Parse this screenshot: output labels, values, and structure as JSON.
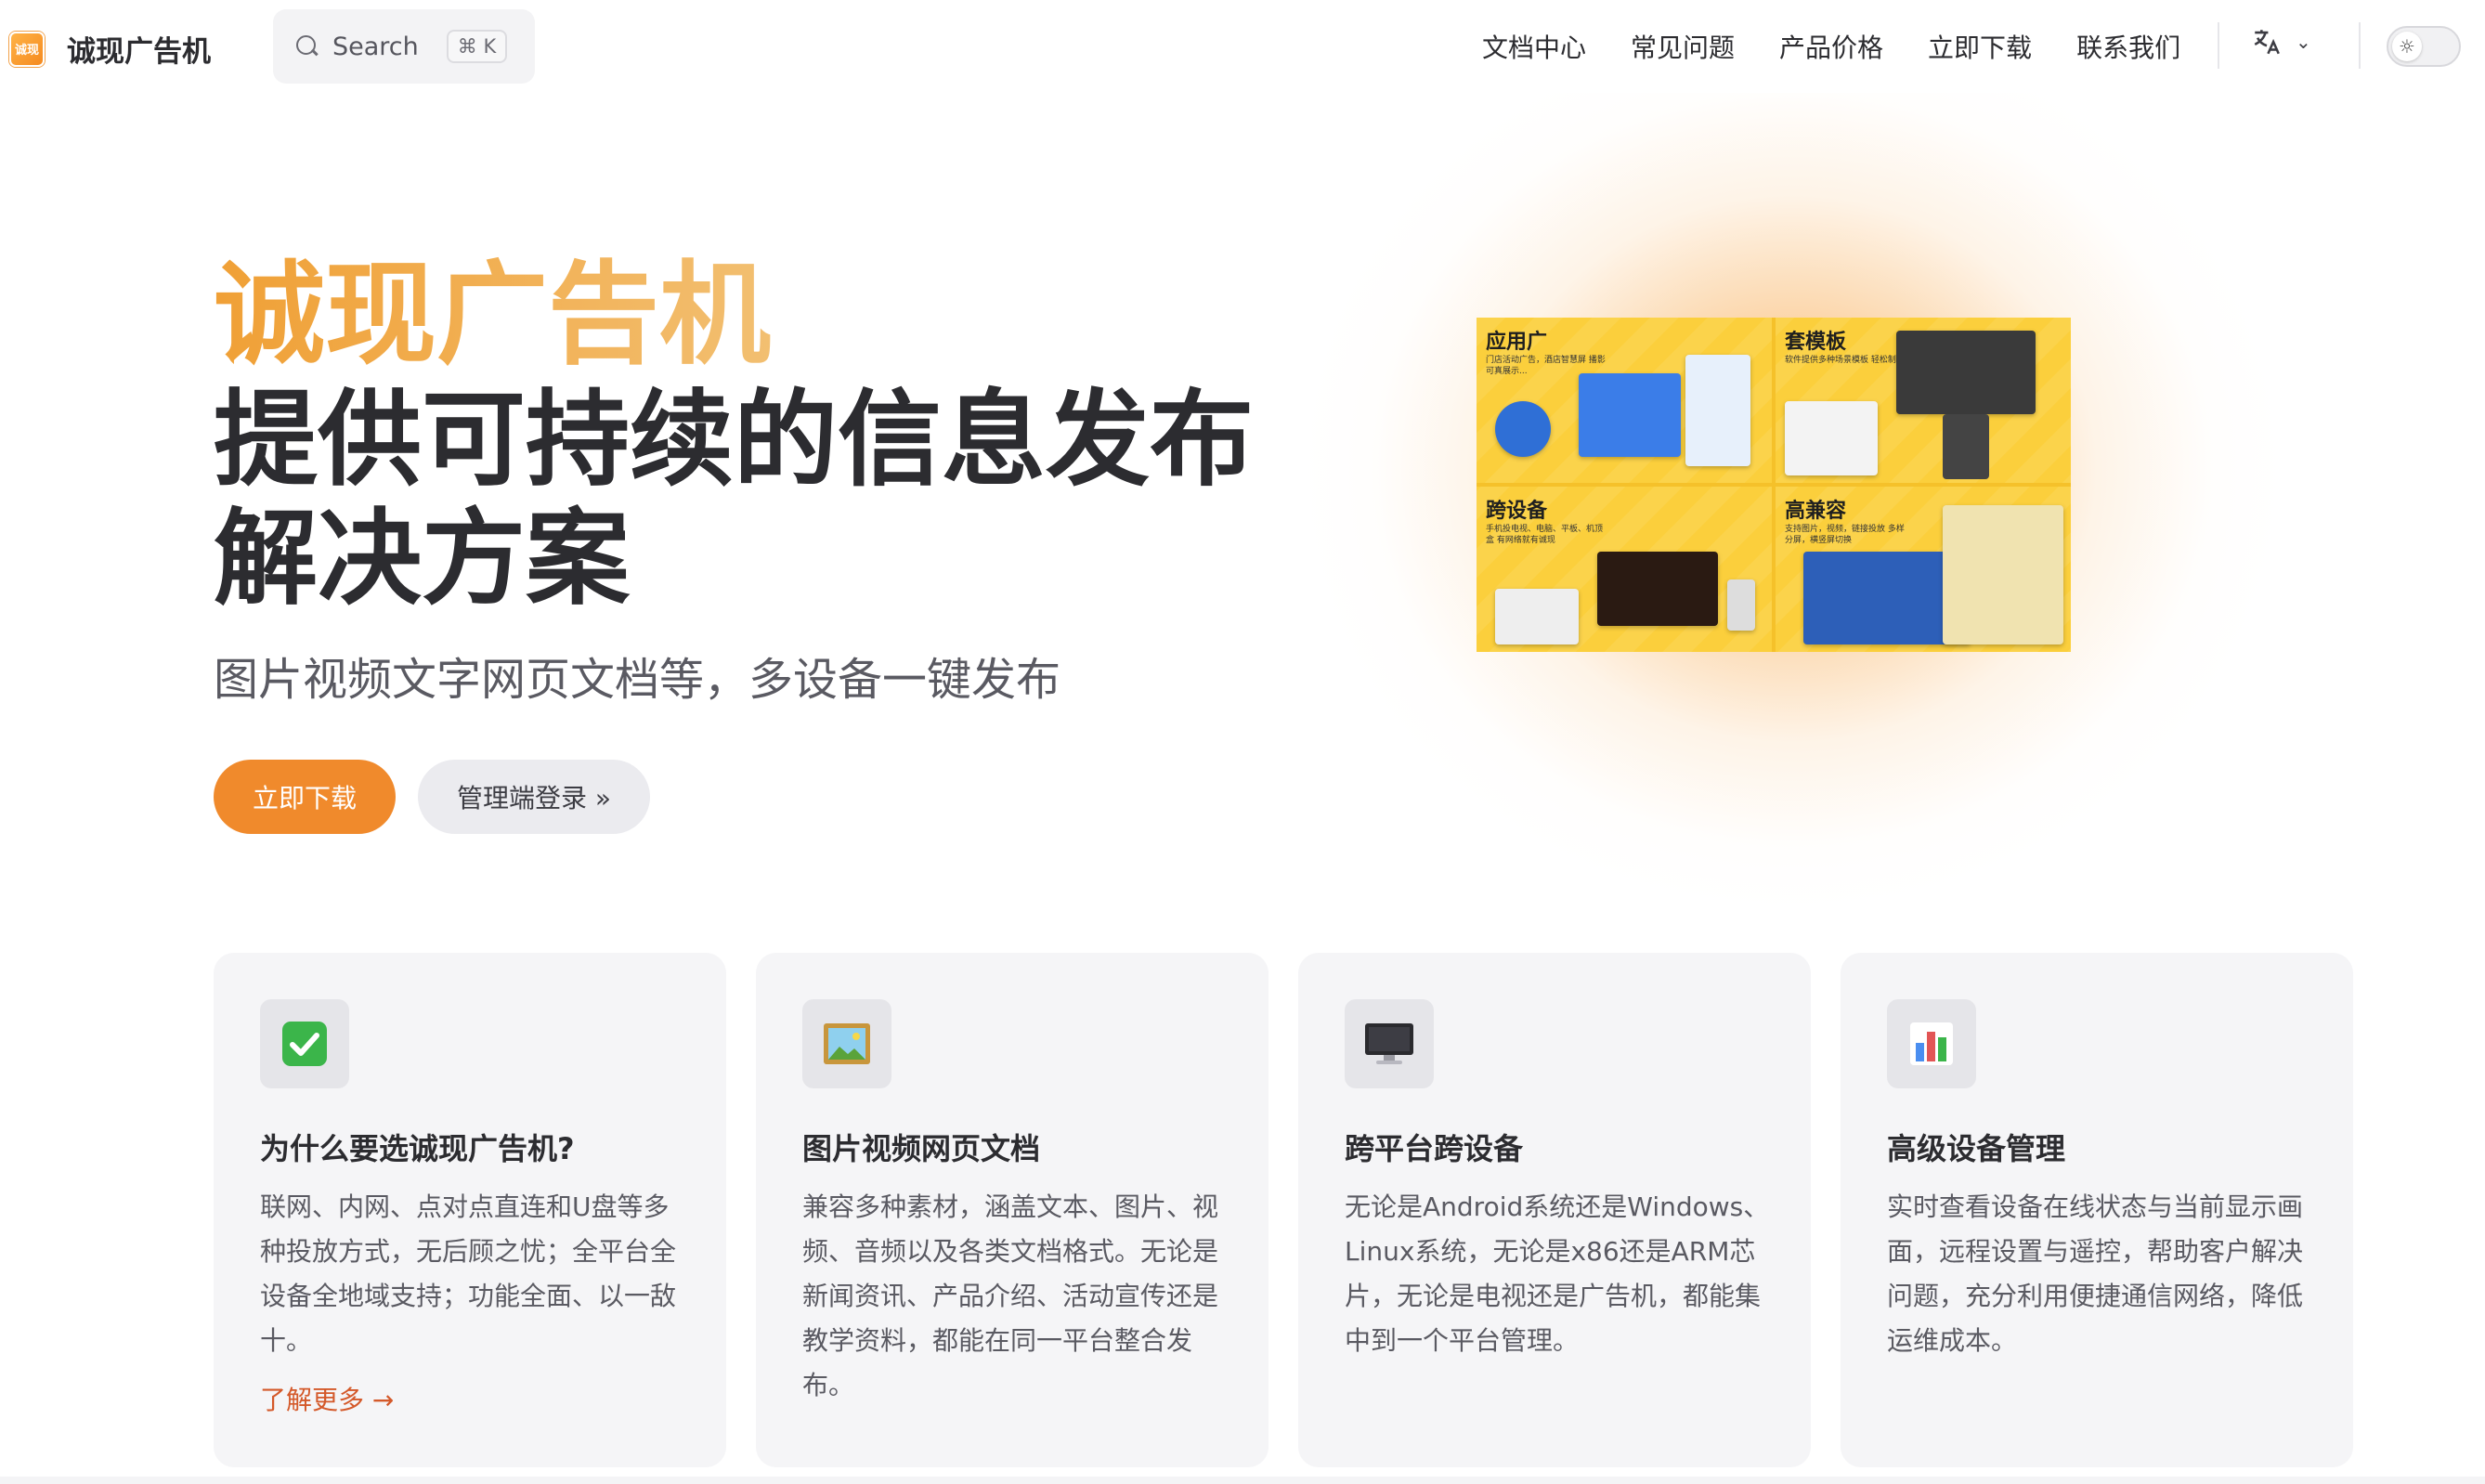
{
  "brand": {
    "logo_text": "诚现",
    "name": "诚现广告机"
  },
  "search": {
    "placeholder": "Search",
    "shortcut": "⌘ K"
  },
  "nav": {
    "links": [
      "文档中心",
      "常见问题",
      "产品价格",
      "立即下载",
      "联系我们"
    ],
    "language_icon": "translate-icon",
    "theme_icon": "sun-icon"
  },
  "hero": {
    "name": "诚现广告机",
    "title_line1": "提供可持续的信息发布",
    "title_line2": "解决方案",
    "tagline": "图片视频文字网页文档等，多设备一键发布",
    "primary_button": "立即下载",
    "secondary_button": "管理端登录 »",
    "image": {
      "quadrants": [
        {
          "title": "应用广",
          "desc": "门店活动广告，酒店智慧屏 播影可真展示..."
        },
        {
          "title": "套模板",
          "desc": "软件提供多种场景模板 轻松制作"
        },
        {
          "title": "跨设备",
          "desc": "手机投电视、电脑、平板、机顶盒 有网络就有诚现"
        },
        {
          "title": "高兼容",
          "desc": "支持图片，视频，链接投放 多样分屏，横竖屏切换"
        }
      ]
    }
  },
  "features": [
    {
      "icon": "check-mark-icon",
      "title": "为什么要选诚现广告机?",
      "text": "联网、内网、点对点直连和U盘等多种投放方式，无后顾之忧；全平台全设备全地域支持；功能全面、以一敌十。",
      "link": "了解更多 →"
    },
    {
      "icon": "picture-icon",
      "title": "图片视频网页文档",
      "text": "兼容多种素材，涵盖文本、图片、视频、音频以及各类文档格式。无论是新闻资讯、产品介绍、活动宣传还是教学资料，都能在同一平台整合发布。"
    },
    {
      "icon": "monitor-icon",
      "title": "跨平台跨设备",
      "text": "无论是Android系统还是Windows、Linux系统，无论是x86还是ARM芯片，无论是电视还是广告机，都能集中到一个平台管理。"
    },
    {
      "icon": "bar-chart-icon",
      "title": "高级设备管理",
      "text": "实时查看设备在线状态与当前显示画面，远程设置与遥控，帮助客户解决问题，充分利用便捷通信网络，降低运维成本。"
    }
  ],
  "colors": {
    "accent": "#f08a2c",
    "link": "#d4592a",
    "banner": "#fbcf3c"
  }
}
